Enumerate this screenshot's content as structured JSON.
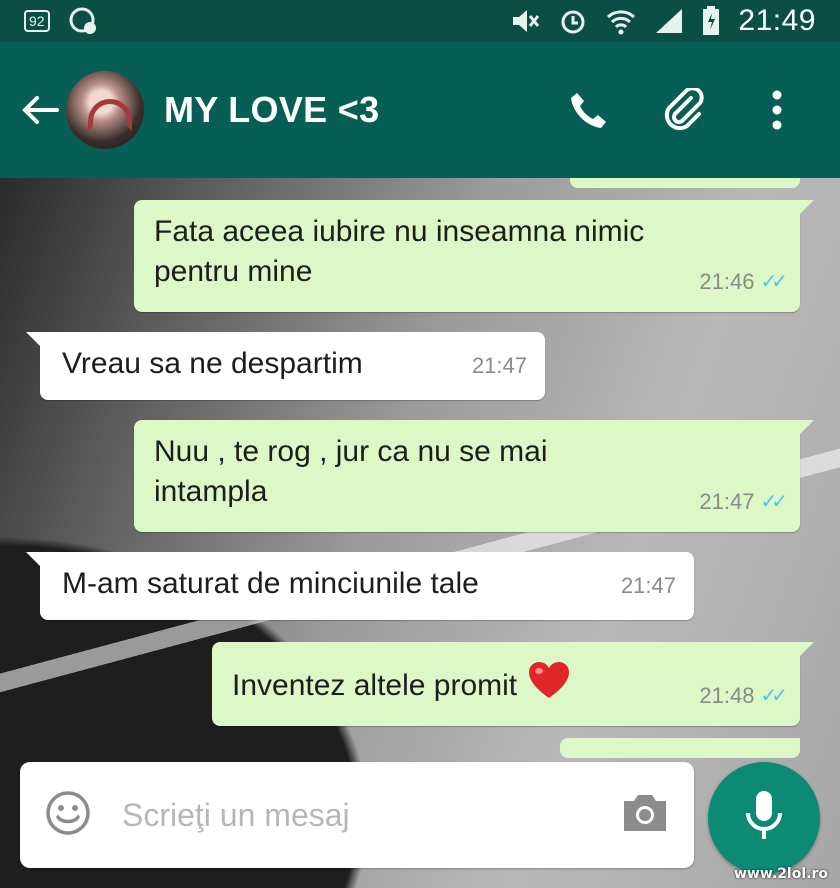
{
  "status_bar": {
    "notification_badge": "92",
    "time": "21:49",
    "icons": [
      "notification-badge-icon",
      "whatsapp-icon",
      "mute-icon",
      "alarm-icon",
      "wifi-icon",
      "signal-icon",
      "battery-icon"
    ]
  },
  "header": {
    "contact_name": "MY LOVE <3",
    "actions": [
      "phone-icon",
      "attach-icon",
      "more-icon"
    ]
  },
  "messages": [
    {
      "direction": "out",
      "text_line1": "Fata aceea iubire nu inseamna nimic",
      "text_line2": "pentru mine",
      "time": "21:46",
      "ticks": "✓✓"
    },
    {
      "direction": "in",
      "text": "Vreau sa ne despartim",
      "time": "21:47"
    },
    {
      "direction": "out",
      "text_line1": "Nuu , te rog , jur ca nu se mai",
      "text_line2": "intampla",
      "time": "21:47",
      "ticks": "✓✓"
    },
    {
      "direction": "in",
      "text": "M-am saturat de minciunile tale",
      "time": "21:47"
    },
    {
      "direction": "out",
      "text": "Inventez altele promit",
      "emoji": "heart-icon",
      "time": "21:48",
      "ticks": "✓✓"
    }
  ],
  "composer": {
    "placeholder": "Scrieţi un mesaj"
  },
  "watermark": "www.2lol.ro",
  "colors": {
    "status_bar": "#0b4f44",
    "header": "#075e54",
    "outgoing_bubble": "#dcf8c6",
    "incoming_bubble": "#ffffff",
    "mic_button": "#0d8a74",
    "read_ticks": "#4fc3f7"
  }
}
